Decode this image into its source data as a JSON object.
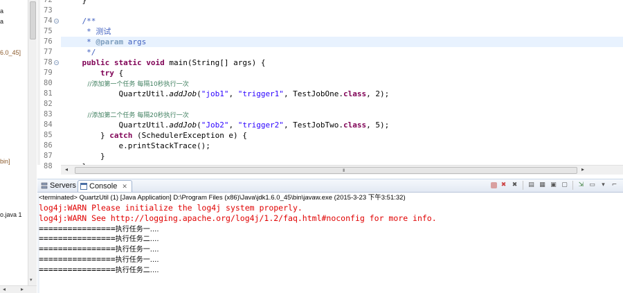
{
  "left_pane": {
    "fragments": [
      "a",
      "a",
      "6.0_45]",
      "bin]",
      "o.java 1"
    ],
    "hscroll_left": "◂",
    "hscroll_right": "▸",
    "vscroll_down": "▾"
  },
  "editor": {
    "lines": [
      {
        "num": "72",
        "text": "    }"
      },
      {
        "num": "73",
        "text": ""
      },
      {
        "num": "74",
        "fold": "⊖",
        "text": "    /**"
      },
      {
        "num": "75",
        "text": "     * 测试"
      },
      {
        "num": "76",
        "text": "     * @param args"
      },
      {
        "num": "77",
        "text": "     */"
      },
      {
        "num": "78",
        "fold": "⊖",
        "text": "    public static void main(String[] args) {"
      },
      {
        "num": "79",
        "text": "        try {"
      },
      {
        "num": "80",
        "text": "            //添加第一个任务 每隔10秒执行一次"
      },
      {
        "num": "81",
        "text": "            QuartzUtil.addJob(\"job1\", \"trigger1\", TestJobOne.class, 2);"
      },
      {
        "num": "82",
        "text": ""
      },
      {
        "num": "83",
        "text": "            //添加第二个任务 每隔20秒执行一次"
      },
      {
        "num": "84",
        "text": "            QuartzUtil.addJob(\"Job2\", \"trigger2\", TestJobTwo.class, 5);"
      },
      {
        "num": "85",
        "text": "        } catch (SchedulerException e) {"
      },
      {
        "num": "86",
        "text": "            e.printStackTrace();"
      },
      {
        "num": "87",
        "text": "        }"
      },
      {
        "num": "88",
        "text": "    }"
      }
    ],
    "hscroll_grip": "III",
    "hscroll_left": "◂",
    "hscroll_right": "▸"
  },
  "console": {
    "tabs": [
      {
        "label": "Servers",
        "icon": "servers-icon"
      },
      {
        "label": "Console",
        "icon": "console-icon",
        "close": "✕"
      }
    ],
    "toolbar_icons": [
      "terminate-icon",
      "remove-launch-icon",
      "remove-all-icon",
      "scroll-lock-icon",
      "show-console-icon",
      "pin-console-icon",
      "display-selected-icon",
      "open-console-icon",
      "minimize-icon",
      "maximize-icon"
    ],
    "terminated_label": "<terminated> QuartzUtil (1) [Java Application] D:\\Program Files (x86)\\Java\\jdk1.6.0_45\\bin\\javaw.exe (2015-3-23 下午3:51:32)",
    "output": [
      {
        "text": "log4j:WARN Please initialize the log4j system properly.",
        "type": "err"
      },
      {
        "text": "log4j:WARN See http://logging.apache.org/log4j/1.2/faq.html#noconfig for more info.",
        "type": "err"
      },
      {
        "text": "================执行任务一....",
        "type": "out"
      },
      {
        "text": "================执行任务二....",
        "type": "out"
      },
      {
        "text": "================执行任务一....",
        "type": "out"
      },
      {
        "text": "================执行任务一....",
        "type": "out"
      },
      {
        "text": "================执行任务二....",
        "type": "out"
      }
    ]
  },
  "colors": {
    "keyword": "#7f0055",
    "javadoc": "#3f5fbf",
    "comment": "#3f7f5f",
    "string": "#2a00ff",
    "stderr": "#e00000",
    "current_line": "#e8f2fe"
  }
}
